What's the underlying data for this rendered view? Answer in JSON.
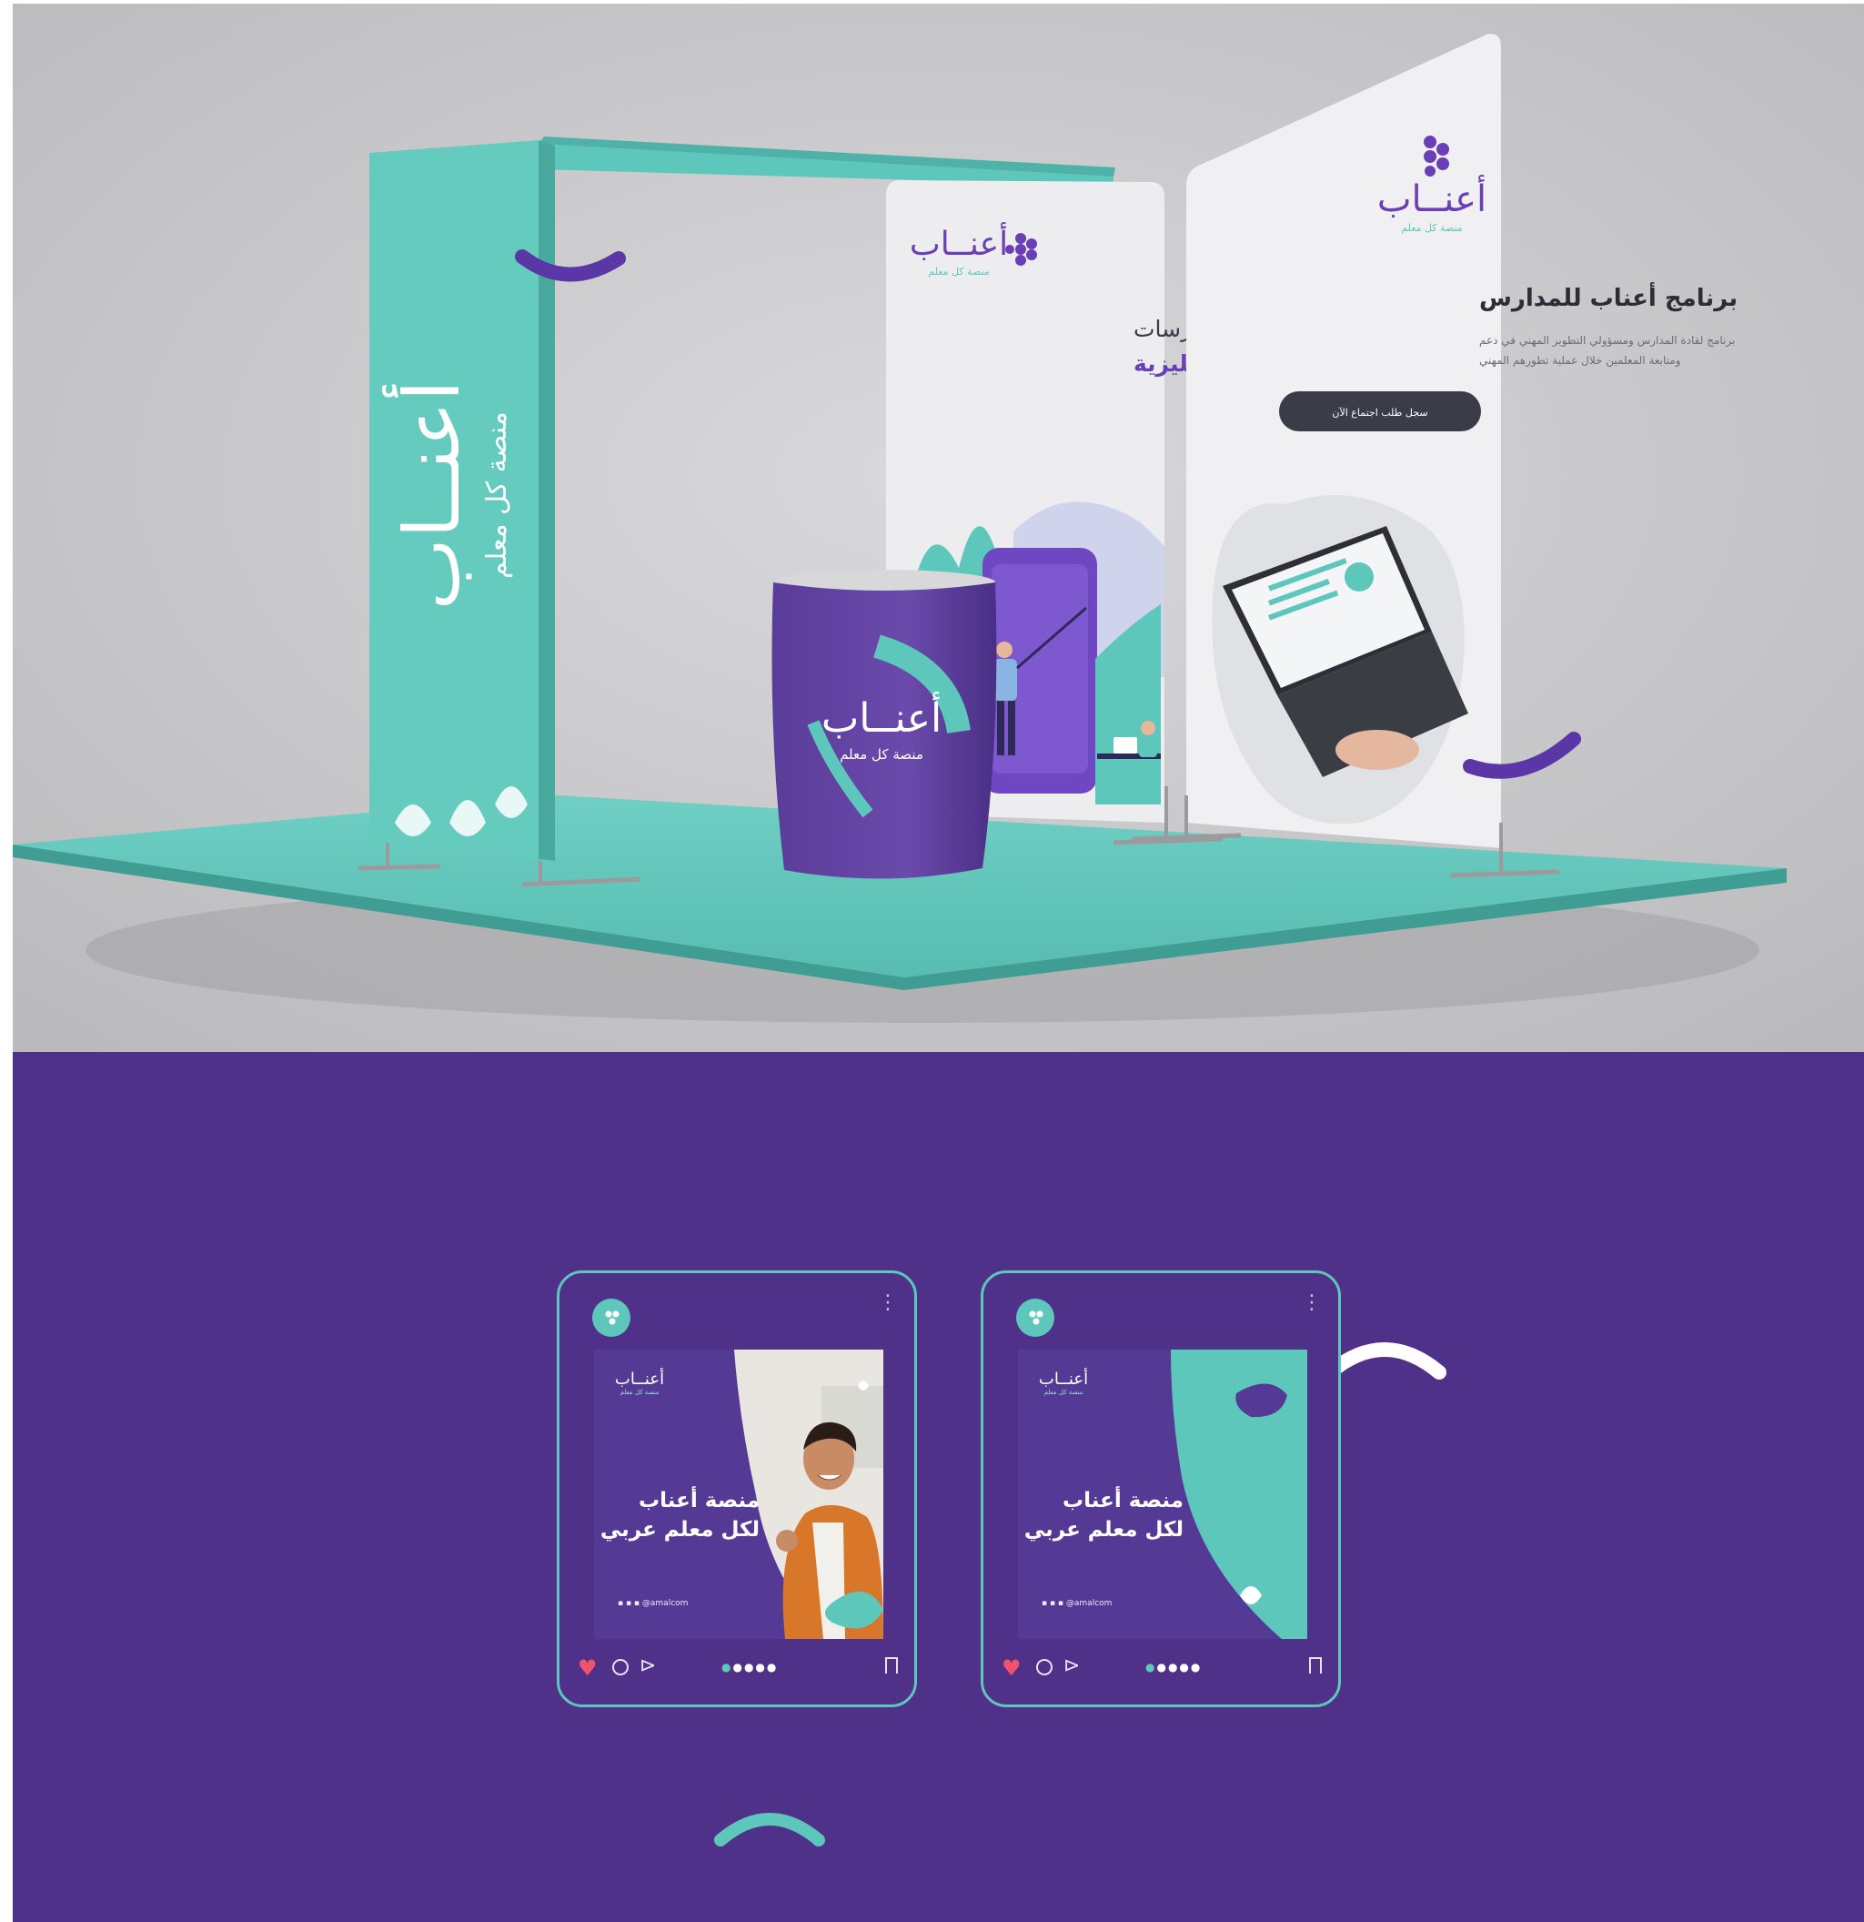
{
  "colors": {
    "purple": "#4f3189",
    "teal": "#5ec7bc",
    "gray_bg": "#c9c9cb",
    "panel_white": "#eeeef0",
    "button_dark": "#3a3c48",
    "heart": "#f1546a"
  },
  "booth": {
    "side_banner": {
      "brand": "أعنــاب",
      "tagline": "منصة كل معلم"
    },
    "middle_panel": {
      "brand": "أعنــاب",
      "brand_sub": "منصة كل معلم",
      "line1": "أحدث التقنيات والممارسات",
      "line2": "لتطوير اللغة الإنجليزية"
    },
    "right_panel": {
      "brand": "أعنــاب",
      "brand_sub": "منصة كل معلم",
      "title": "برنامج أعناب للمدارس",
      "body_line1": "برنامج لقادة المدارس ومسؤولي التطوير المهني في دعم",
      "body_line2": "ومتابعة المعلمين خلال عملية تطورهم المهني",
      "button": "سجل طلب اجتماع الآن"
    },
    "podium": {
      "brand": "أعنــاب",
      "tagline": "منصة كل معلم"
    }
  },
  "posts": [
    {
      "brand": "أعنــاب",
      "brand_sub": "منصة كل معلم",
      "headline_line1": "منصة أعناب",
      "headline_line2": "لكل معلم عربي",
      "handle": "@amalcom",
      "icons": [
        "profile-avatar-icon",
        "kebab-menu-icon",
        "heart-icon",
        "comment-icon",
        "send-icon",
        "carousel-dots-icon",
        "bookmark-icon"
      ]
    },
    {
      "brand": "أعنــاب",
      "brand_sub": "منصة كل معلم",
      "headline_line1": "منصة أعناب",
      "headline_line2": "لكل معلم عربي",
      "handle": "@amalcom",
      "icons": [
        "profile-avatar-icon",
        "kebab-menu-icon",
        "heart-icon",
        "comment-icon",
        "send-icon",
        "carousel-dots-icon",
        "bookmark-icon"
      ]
    }
  ]
}
